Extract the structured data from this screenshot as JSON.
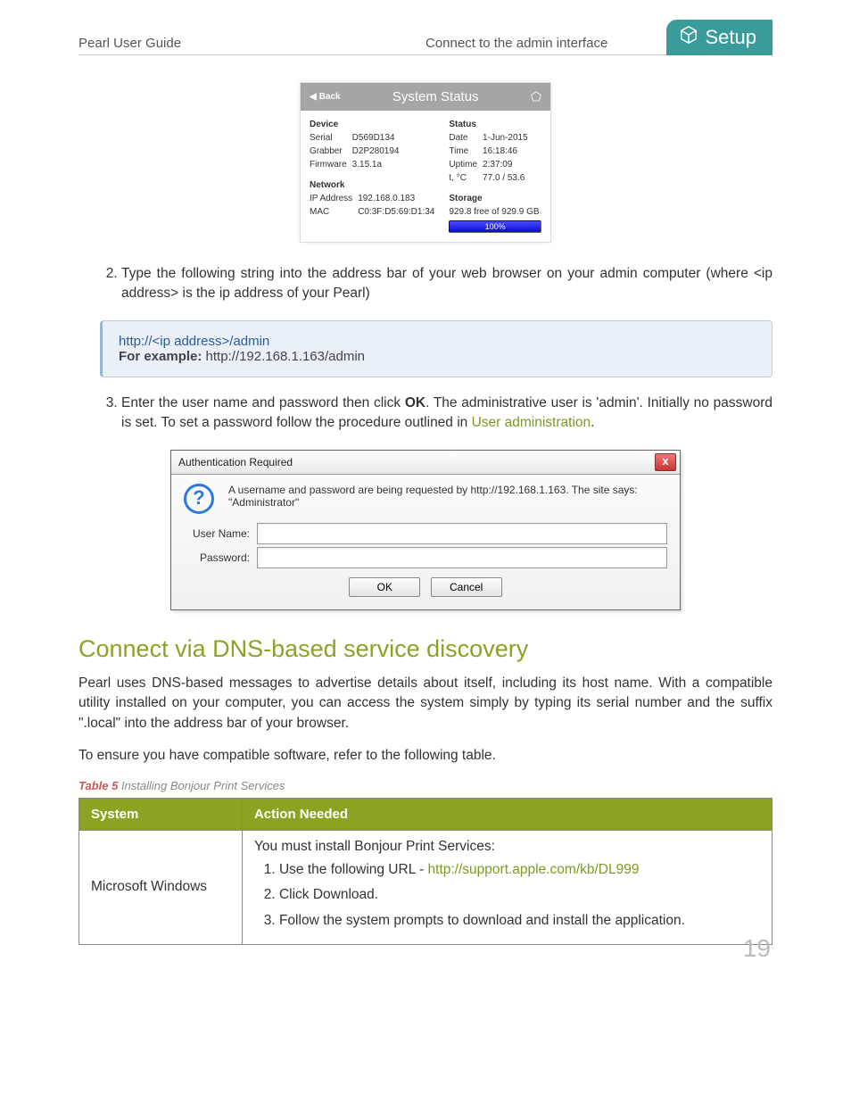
{
  "header": {
    "left": "Pearl User Guide",
    "center": "Connect to the admin interface",
    "tab": "Setup"
  },
  "status_panel": {
    "back_label": "Back",
    "title": "System Status",
    "device_heading": "Device",
    "device_rows": [
      {
        "k": "Serial",
        "v": "D569D134"
      },
      {
        "k": "Grabber",
        "v": "D2P280194"
      },
      {
        "k": "Firmware",
        "v": "3.15.1a"
      }
    ],
    "network_heading": "Network",
    "network_rows": [
      {
        "k": "IP Address",
        "v": "192.168.0.183"
      },
      {
        "k": "MAC",
        "v": "C0:3F:D5:69:D1:34"
      }
    ],
    "status_heading": "Status",
    "status_rows": [
      {
        "k": "Date",
        "v": "1-Jun-2015"
      },
      {
        "k": "Time",
        "v": "16:18:46"
      },
      {
        "k": "Uptime",
        "v": "2:37:09"
      },
      {
        "k": "t, °C",
        "v": "77.0 / 53.6"
      }
    ],
    "storage_heading": "Storage",
    "storage_text": "929.8 free of 929.9 GB",
    "storage_pct": "100%"
  },
  "step2": {
    "text_a": "Type the following string into the address bar of your web browser on your admin computer (where <ip address> is the ip address of your Pearl)"
  },
  "codebox": {
    "line1": "http://<ip address>/admin",
    "ex_label": "For example:",
    "ex_value": " http://192.168.1.163/admin"
  },
  "step3": {
    "pre": "Enter the user name and password then click ",
    "ok": "OK",
    "mid": ". The administrative user is 'admin'. Initially no password is set. To set a password follow the procedure outlined in ",
    "link": "User administration",
    "post": "."
  },
  "auth_dialog": {
    "title": "Authentication Required",
    "message": "A username and password are being requested by http://192.168.1.163. The site says: \"Administrator\"",
    "user_label": "User Name:",
    "pass_label": "Password:",
    "ok": "OK",
    "cancel": "Cancel"
  },
  "dns_heading": "Connect via DNS-based service discovery",
  "dns_p1": "Pearl uses DNS-based messages to advertise details about itself, including its host name. With a compatible utility installed on your computer, you can access the system simply by typing its serial number and the suffix \".local\" into the address bar of your browser.",
  "dns_p2": "To ensure you have compatible software, refer to the following table.",
  "table_caption_lbl": "Table 5",
  "table_caption_txt": " Installing Bonjour Print Services",
  "table": {
    "h1": "System",
    "h2": "Action Needed",
    "r1_c1": "Microsoft Windows",
    "r1_intro": "You must install Bonjour Print Services:",
    "r1_li1_pre": "Use the following URL - ",
    "r1_li1_url": "http://support.apple.com/kb/DL999",
    "r1_li2": "Click Download.",
    "r1_li3": "Follow the system prompts to download and install the application."
  },
  "page_number": "19"
}
